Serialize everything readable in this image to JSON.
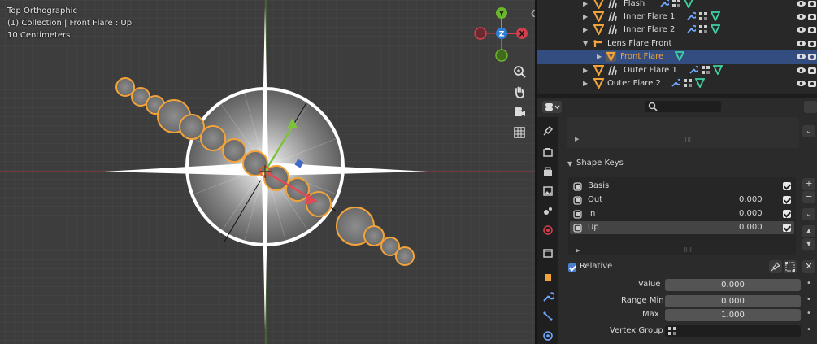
{
  "viewport": {
    "view_name": "Top Orthographic",
    "collection_info": "(1) Collection | Front Flare : Up",
    "scale": "10 Centimeters",
    "gizmo": {
      "y": "Y",
      "z": "Z",
      "x": "X"
    }
  },
  "colors": {
    "accent_orange": "#f2a33a",
    "selection_blue": "#334d80",
    "axis_red": "#d13f4c",
    "axis_green": "#6db52d",
    "axis_blue": "#2f7fd6"
  },
  "outliner": {
    "items": [
      {
        "label": "Flash",
        "icon": "mesh-object-icon",
        "expanded": false
      },
      {
        "label": "Inner Flare 1",
        "icon": "mesh-object-icon",
        "expanded": false
      },
      {
        "label": "Inner Flare 2",
        "icon": "mesh-object-icon",
        "expanded": false
      },
      {
        "label": "Lens Flare Front",
        "icon": "armature-icon",
        "expanded": true
      },
      {
        "label": "Front Flare",
        "icon": "mesh-data-icon",
        "expanded": false,
        "selected": true
      },
      {
        "label": "Outer Flare 1",
        "icon": "mesh-object-icon",
        "expanded": false
      },
      {
        "label": "Outer Flare 2",
        "icon": "mesh-object-icon",
        "expanded": false
      }
    ]
  },
  "properties": {
    "shape_keys_title": "Shape Keys",
    "keys": [
      {
        "name": "Basis",
        "value": ""
      },
      {
        "name": "Out",
        "value": "0.000"
      },
      {
        "name": "In",
        "value": "0.000"
      },
      {
        "name": "Up",
        "value": "0.000"
      }
    ],
    "relative_label": "Relative",
    "value_label": "Value",
    "value": "0.000",
    "range_min_label": "Range Min",
    "range_min": "0.000",
    "max_label": "Max",
    "max": "1.000",
    "vertex_group_label": "Vertex Group"
  }
}
